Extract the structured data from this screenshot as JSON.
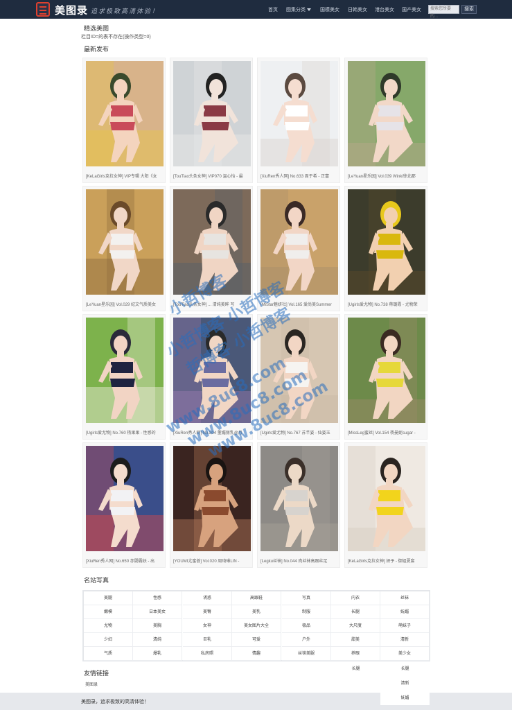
{
  "brand": {
    "name": "美图录",
    "slogan": "追求极致高清体验！"
  },
  "nav": [
    {
      "label": "首页"
    },
    {
      "label": "图集分类"
    },
    {
      "label": "国模美女"
    },
    {
      "label": "日韩美女"
    },
    {
      "label": "港台美女"
    },
    {
      "label": "国产美女"
    }
  ],
  "search": {
    "placeholder": "搜索您所要的...",
    "button": "搜索"
  },
  "featured_title": "精选美图",
  "notice": "栏目ID=的表不存在(操作类型=0)",
  "latest_title": "最新发布",
  "cards": [
    {
      "caption": "[KeLaGirls克拉女神] VIP专辑 大阳《女"
    },
    {
      "caption": "[TouTiao头条女神] VIP070 温心怡 - 最"
    },
    {
      "caption": "[XiuRen秀人网] No.633 周于希 - 正富"
    },
    {
      "caption": "[LeYuan星乐园] Vol.039 Winki徐北郡"
    },
    {
      "caption": "[LeYuan星乐园] Vol.029 纪文气质美女"
    },
    {
      "caption": "[TouTiao头条女神] ... 清纯美眸 写"
    },
    {
      "caption": "[MiStar魅妍社] Vol.165 爱尚美Summer"
    },
    {
      "caption": "[Ugirls爱尤物] No.738 蒋璐霞 - 尤物荣"
    },
    {
      "caption": "[Ugirls爱尤物] No.760 杨果果 - 性感的"
    },
    {
      "caption": "[XiuRen秀人网] No.804 董媚丽乳@月"
    },
    {
      "caption": "[Ugirls爱尤物] No.767 苏芊姿 - 仙姿玉"
    },
    {
      "caption": "[MissLeg蜜丝] Vol.154 杨曼妮sugar -"
    },
    {
      "caption": "[XiuRen秀人网] No.650 赤闘霸妖 - 出"
    },
    {
      "caption": "[YOUMI尤蜜荟] Vol.020 周琦琳LIN -"
    },
    {
      "caption": "[Legku丝袜] No.044 肉丝袜高跟丝足"
    },
    {
      "caption": "[KeLaGirls克拉女神] 妍予 - 御姐夏套"
    }
  ],
  "sites_title": "名站写真",
  "tags": [
    [
      "美腿",
      "性感",
      "诱惑",
      "高跟鞋",
      "写真",
      "内衣",
      "丝袜"
    ],
    [
      "嫩模",
      "日本美女",
      "美臀",
      "美乳",
      "制服",
      "长腿",
      "妩媚"
    ],
    [
      "尤物",
      "美胸",
      "女神",
      "美女图片大全",
      "极品",
      "大尺度",
      "萌妹子"
    ],
    [
      "少妇",
      "清纯",
      "巨乳",
      "可爱",
      "户外",
      "甜美",
      "清新"
    ],
    [
      "气质",
      "爆乳",
      "私房照",
      "情趣",
      "丝袜美腿",
      "养眼",
      "美少女"
    ]
  ],
  "tag_overflow": [
    "长腿",
    "长腿",
    "清新",
    "妩媚"
  ],
  "friends_title": "友情链接",
  "friends": [
    "美图录"
  ],
  "footer": "美图录，追求极致的高清体验！",
  "watermark": [
    "小哲博客",
    "小哲博客 小哲博客",
    "哲博客 小哲博客",
    "www.8uc8.com",
    "www.8uc8.com",
    "www.8uc8.com"
  ]
}
